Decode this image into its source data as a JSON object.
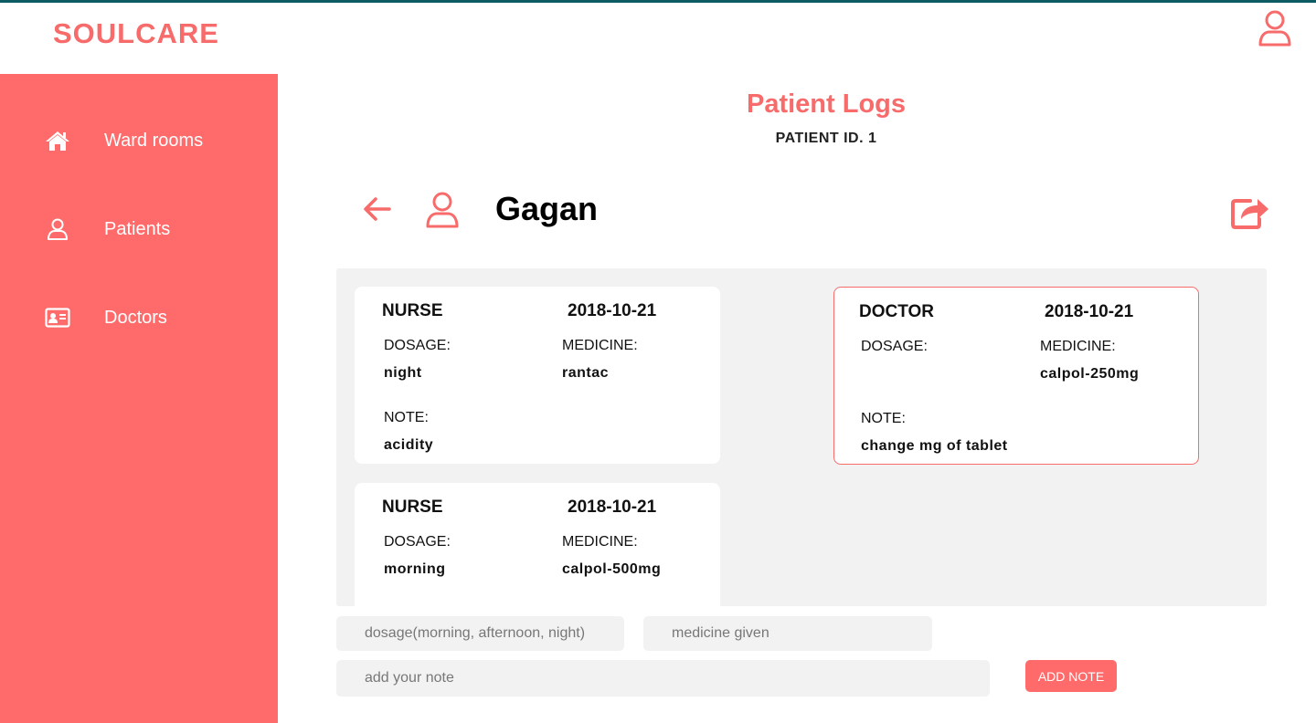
{
  "app": {
    "brand": "SOULCARE"
  },
  "sidebar": {
    "items": [
      {
        "label": "Ward rooms",
        "icon": "home-icon"
      },
      {
        "label": "Patients",
        "icon": "user-icon"
      },
      {
        "label": "Doctors",
        "icon": "id-card-icon"
      }
    ]
  },
  "page": {
    "title": "Patient Logs",
    "subtitle": "PATIENT ID. 1",
    "patient_name": "Gagan"
  },
  "logs": [
    {
      "role": "NURSE",
      "date": "2018-10-21",
      "dosage_label": "DOSAGE:",
      "dosage": "night",
      "medicine_label": "MEDICINE:",
      "medicine": "rantac",
      "note_label": "NOTE:",
      "note": "acidity"
    },
    {
      "role": "DOCTOR",
      "date": "2018-10-21",
      "dosage_label": "DOSAGE:",
      "dosage": "",
      "medicine_label": "MEDICINE:",
      "medicine": "calpol-250mg",
      "note_label": "NOTE:",
      "note": "change mg of tablet"
    },
    {
      "role": "NURSE",
      "date": "2018-10-21",
      "dosage_label": "DOSAGE:",
      "dosage": "morning",
      "medicine_label": "MEDICINE:",
      "medicine": "calpol-500mg"
    }
  ],
  "form": {
    "dosage_placeholder": "dosage(morning, afternoon, night)",
    "medicine_placeholder": "medicine given",
    "note_placeholder": "add your note",
    "submit_label": "ADD NOTE"
  },
  "colors": {
    "accent": "#ff6b6b",
    "brand": "#f76b6b",
    "panel": "#f2f2f2",
    "topline": "#0e5b63"
  }
}
